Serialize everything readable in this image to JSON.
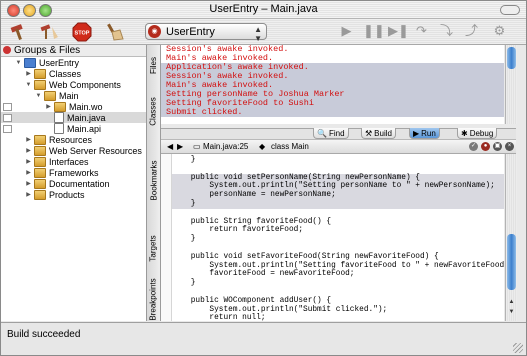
{
  "window": {
    "title": "UserEntry – Main.java"
  },
  "toolbar": {
    "target": "UserEntry",
    "build_icon": "hammer-icon",
    "clean_icon": "hammer-broom-icon",
    "stop_label": "STOP",
    "broom_icon": "broom-icon"
  },
  "groups": {
    "header": "Groups & Files",
    "items": [
      {
        "label": "UserEntry",
        "depth": 0,
        "expanded": true,
        "kind": "project"
      },
      {
        "label": "Classes",
        "depth": 1,
        "expanded": false,
        "kind": "folder"
      },
      {
        "label": "Web Components",
        "depth": 1,
        "expanded": true,
        "kind": "folder"
      },
      {
        "label": "Main",
        "depth": 2,
        "expanded": true,
        "kind": "folder"
      },
      {
        "label": "Main.wo",
        "depth": 3,
        "expanded": false,
        "kind": "folder"
      },
      {
        "label": "Main.java",
        "depth": 3,
        "kind": "file",
        "selected": true
      },
      {
        "label": "Main.api",
        "depth": 3,
        "kind": "file"
      },
      {
        "label": "Resources",
        "depth": 1,
        "expanded": false,
        "kind": "folder"
      },
      {
        "label": "Web Server Resources",
        "depth": 1,
        "expanded": false,
        "kind": "folder"
      },
      {
        "label": "Interfaces",
        "depth": 1,
        "expanded": false,
        "kind": "folder"
      },
      {
        "label": "Frameworks",
        "depth": 1,
        "expanded": false,
        "kind": "folder"
      },
      {
        "label": "Documentation",
        "depth": 1,
        "expanded": false,
        "kind": "folder"
      },
      {
        "label": "Products",
        "depth": 1,
        "expanded": false,
        "kind": "folder"
      }
    ]
  },
  "side_tabs": [
    "Files",
    "Classes",
    "Bookmarks",
    "Targets",
    "Breakpoints"
  ],
  "log": {
    "lines": [
      {
        "text": "Session's awake invoked.",
        "hl": false
      },
      {
        "text": "Main's awake invoked.",
        "hl": false
      },
      {
        "text": "Application's awake invoked.",
        "hl": true
      },
      {
        "text": "Session's awake invoked.",
        "hl": true
      },
      {
        "text": "Main's awake invoked.",
        "hl": true
      },
      {
        "text": "Setting personName to Joshua Marker",
        "hl": true
      },
      {
        "text": "Setting favoriteFood to Sushi",
        "hl": true
      },
      {
        "text": "Submit clicked.",
        "hl": true
      }
    ]
  },
  "tabs": {
    "find": "Find",
    "build": "Build",
    "run": "Run",
    "debug": "Debug"
  },
  "editor_nav": {
    "file": "Main.java:25",
    "symbol": "class Main"
  },
  "code": {
    "lines": [
      {
        "text": "    }",
        "hl": false
      },
      {
        "text": "",
        "hl": false
      },
      {
        "text": "    public void setPersonName(String newPersonName) {",
        "hl": true
      },
      {
        "text": "        System.out.println(\"Setting personName to \" + newPersonName);",
        "hl": true
      },
      {
        "text": "        personName = newPersonName;",
        "hl": true
      },
      {
        "text": "    }",
        "hl": true
      },
      {
        "text": "",
        "hl": false
      },
      {
        "text": "    public String favoriteFood() {",
        "hl": false
      },
      {
        "text": "        return favoriteFood;",
        "hl": false
      },
      {
        "text": "    }",
        "hl": false
      },
      {
        "text": "",
        "hl": false
      },
      {
        "text": "    public void setFavoriteFood(String newFavoriteFood) {",
        "hl": false
      },
      {
        "text": "        System.out.println(\"Setting favoriteFood to \" + newFavoriteFood);",
        "hl": false
      },
      {
        "text": "        favoriteFood = newFavoriteFood;",
        "hl": false
      },
      {
        "text": "    }",
        "hl": false
      },
      {
        "text": "",
        "hl": false
      },
      {
        "text": "    public WOComponent addUser() {",
        "hl": false
      },
      {
        "text": "        System.out.println(\"Submit clicked.\");",
        "hl": false
      },
      {
        "text": "        return null;",
        "hl": false
      }
    ]
  },
  "status": {
    "text": "Build succeeded"
  },
  "colors": {
    "log_text": "#d20f0f",
    "selection": "#c8cbd9",
    "accent": "#3b7fcd"
  }
}
